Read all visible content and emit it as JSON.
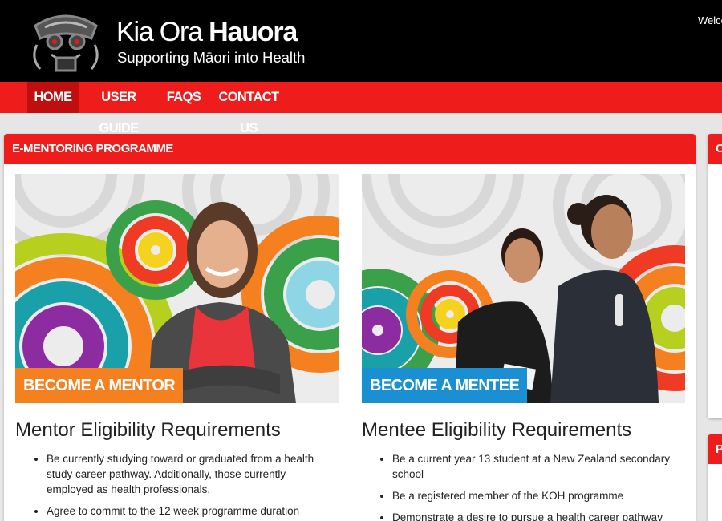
{
  "header": {
    "brand_light": "Kia Ora ",
    "brand_bold": "Hauora",
    "tagline": "Supporting Māori into Health",
    "welcome": "Welco"
  },
  "nav": {
    "items": [
      {
        "label": "HOME",
        "active": true
      },
      {
        "label": "USER GUIDE",
        "active": false
      },
      {
        "label": "FAQS",
        "active": false
      },
      {
        "label": "CONTACT US",
        "active": false
      }
    ]
  },
  "panel": {
    "title": "E-MENTORING PROGRAMME"
  },
  "side_panels": [
    {
      "title": "C"
    },
    {
      "title": "P"
    }
  ],
  "mentor": {
    "button": "BECOME A MENTOR",
    "heading": "Mentor Eligibility Requirements",
    "requirements": [
      "Be currently studying toward or graduated from a health study career pathway. Additionally, those currently employed as health professionals.",
      "Agree to commit to the 12 week programme duration"
    ]
  },
  "mentee": {
    "button": "BECOME A MENTEE",
    "heading": "Mentee Eligibility Requirements",
    "requirements": [
      "Be a current year 13 student at a New Zealand secondary school",
      "Be a registered member of the KOH programme",
      "Demonstrate a desire to pursue a health career pathway"
    ]
  },
  "colors": {
    "brand_red": "#ef1c1c",
    "nav_active": "#c00d0d",
    "mentor_orange": "#f5801f",
    "mentee_blue": "#1a8fd1"
  }
}
